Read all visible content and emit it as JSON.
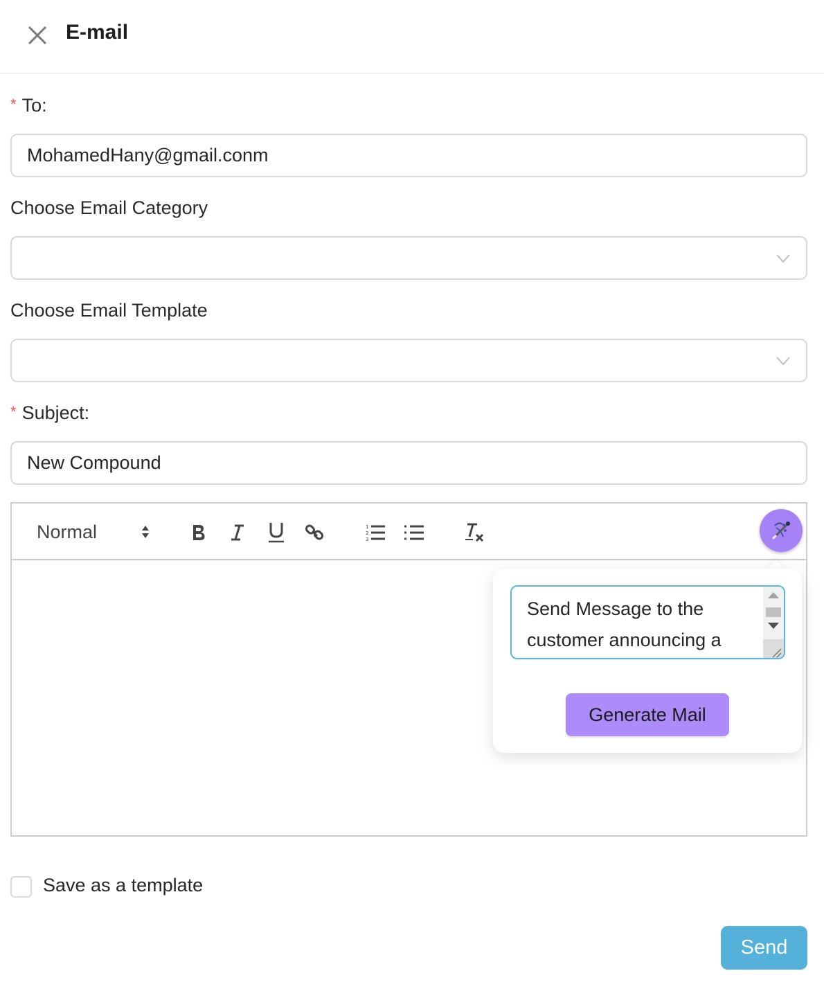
{
  "header": {
    "title": "E-mail",
    "close_icon": "close-icon"
  },
  "form": {
    "to": {
      "label": "To:",
      "required_mark": "*",
      "value": "MohamedHany@gmail.conm"
    },
    "category": {
      "label": "Choose Email Category",
      "value": ""
    },
    "template": {
      "label": "Choose Email Template",
      "value": ""
    },
    "subject": {
      "label": "Subject:",
      "required_mark": "*",
      "value": "New Compound"
    }
  },
  "editor": {
    "toolbar": {
      "heading_select": "Normal",
      "buttons": [
        "bold",
        "italic",
        "underline",
        "link",
        "ordered-list",
        "bullet-list",
        "clear-formatting"
      ],
      "ai_button_icon": "magic-wand-icon"
    },
    "body": ""
  },
  "ai_popover": {
    "prompt_value": "Send Message to the customer announcing a",
    "generate_label": "Generate Mail"
  },
  "footer": {
    "save_template_label": "Save as a template",
    "save_template_checked": false,
    "send_label": "Send"
  },
  "colors": {
    "accent_purple": "#ad8bfa",
    "send_blue": "#55b0da",
    "required_red": "#ff4d4f",
    "focus_border": "#5ab4e0"
  }
}
